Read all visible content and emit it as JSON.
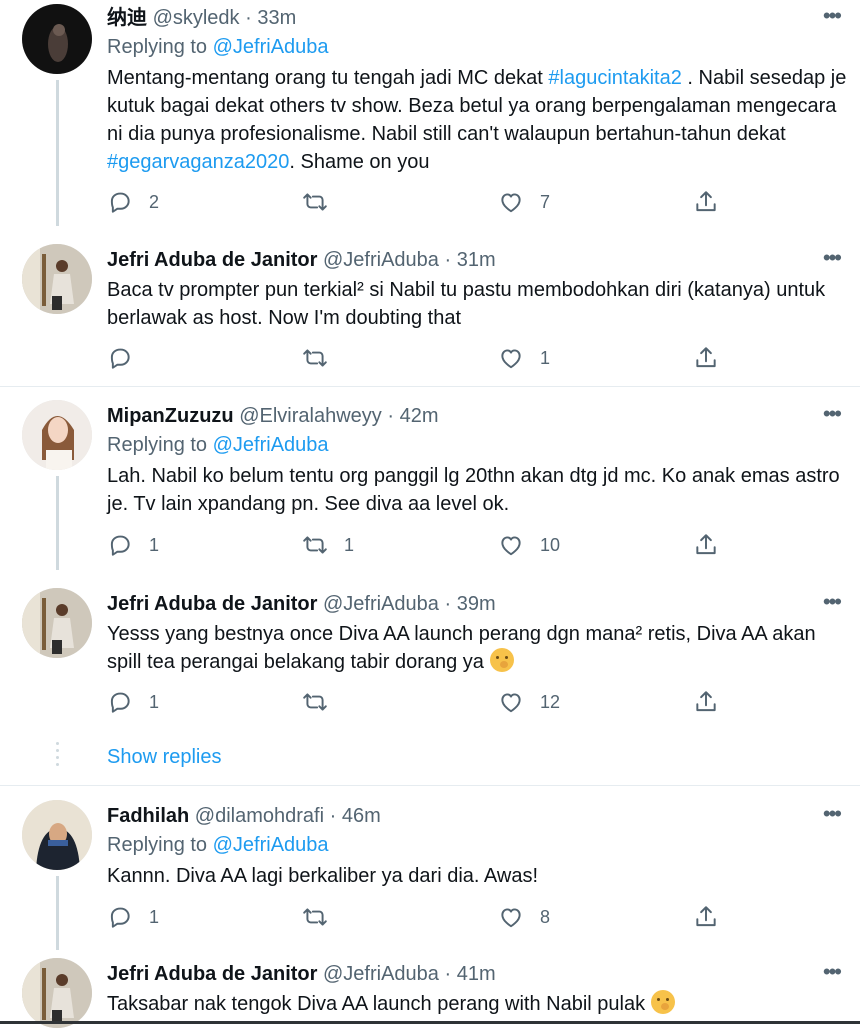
{
  "tweets": [
    {
      "name": "纳迪",
      "handle": "@skyledk",
      "time": "33m",
      "replying_prefix": "Replying to ",
      "replying_to": "@JefriAduba",
      "text_parts": [
        "Mentang-mentang orang tu tengah jadi MC dekat ",
        "#lagucintakita2",
        " . Nabil sesedap je kutuk bagai dekat others tv show. Beza betul ya orang berpengalaman mengecara ni dia punya profesionalisme. Nabil still can't walaupun bertahun-tahun dekat ",
        "#gegarvaganza2020",
        ". Shame on you"
      ],
      "replies": "2",
      "retweets": "",
      "likes": "7"
    },
    {
      "name": "Jefri Aduba de Janitor",
      "handle": "@JefriAduba",
      "time": "31m",
      "text": "Baca tv prompter pun terkial² si Nabil tu pastu membodohkan diri (katanya) untuk berlawak as host. Now I'm doubting that",
      "replies": "",
      "retweets": "",
      "likes": "1"
    },
    {
      "name": "MipanZuzuzu",
      "handle": "@Elviralahweyy",
      "time": "42m",
      "replying_prefix": "Replying to ",
      "replying_to": "@JefriAduba",
      "text": "Lah. Nabil ko belum tentu org panggil lg 20thn akan dtg jd mc. Ko anak emas astro je. Tv lain xpandang pn. See diva aa level ok.",
      "replies": "1",
      "retweets": "1",
      "likes": "10"
    },
    {
      "name": "Jefri Aduba de Janitor",
      "handle": "@JefriAduba",
      "time": "39m",
      "text": "Yesss yang bestnya once Diva AA launch perang dgn mana² retis, Diva AA akan spill tea perangai belakang tabir dorang ya",
      "emoji": "face-with-hand-over-mouth",
      "replies": "1",
      "retweets": "",
      "likes": "12"
    },
    {
      "name": "Fadhilah",
      "handle": "@dilamohdrafi",
      "time": "46m",
      "replying_prefix": "Replying to ",
      "replying_to": "@JefriAduba",
      "text": "Kannn. Diva AA lagi berkaliber ya dari dia. Awas!",
      "replies": "1",
      "retweets": "",
      "likes": "8"
    },
    {
      "name": "Jefri Aduba de Janitor",
      "handle": "@JefriAduba",
      "time": "41m",
      "text": "Taksabar nak tengok Diva AA launch perang with Nabil pulak",
      "emoji": "face-with-hand-over-mouth"
    }
  ],
  "show_replies": "Show replies",
  "separator": "·",
  "icons": {
    "reply": "reply-icon",
    "retweet": "retweet-icon",
    "like": "heart-icon",
    "share": "share-icon",
    "more": "more-icon"
  },
  "colors": {
    "link": "#1d9bf0",
    "muted": "#536471",
    "text": "#0f1419"
  }
}
